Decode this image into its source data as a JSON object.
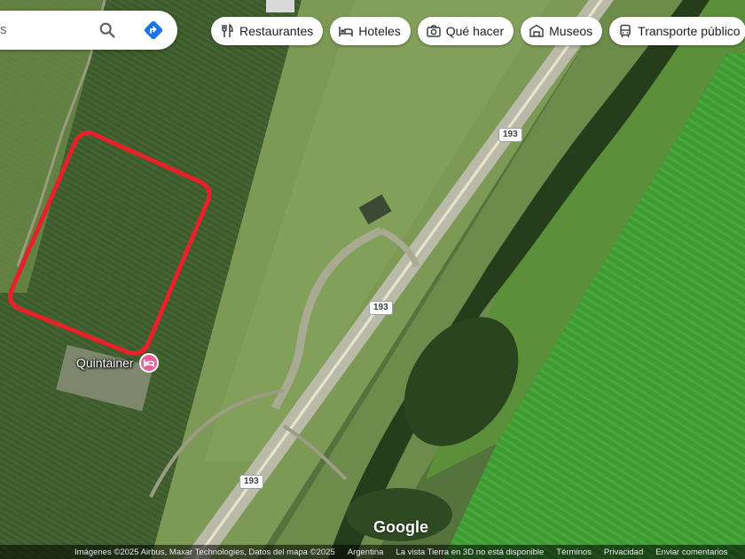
{
  "search": {
    "partial_text": "s"
  },
  "icons": {
    "search": "search-icon",
    "directions": "directions-icon"
  },
  "chips": [
    {
      "label": "Restaurantes",
      "icon": "restaurant-icon"
    },
    {
      "label": "Hoteles",
      "icon": "hotel-icon"
    },
    {
      "label": "Qué hacer",
      "icon": "camera-icon"
    },
    {
      "label": "Museos",
      "icon": "museum-icon"
    },
    {
      "label": "Transporte público",
      "icon": "transit-icon"
    }
  ],
  "map": {
    "route_shields": [
      "193",
      "193",
      "193"
    ],
    "place": {
      "name": "Quintainer",
      "icon": "hotel-pin-icon"
    },
    "highlight_color": "#e8202a",
    "logo": "Google"
  },
  "attribution": {
    "imagery": "Imágenes ©2025 Airbus, Maxar Technologies, Datos del mapa ©2025",
    "country": "Argentina",
    "notice": "La vista Tierra en 3D no está disponible",
    "terms": "Términos",
    "privacy": "Privacidad",
    "feedback": "Enviar comentarios"
  },
  "colors": {
    "accent": "#1a73e8",
    "pin": "#e8609b"
  }
}
